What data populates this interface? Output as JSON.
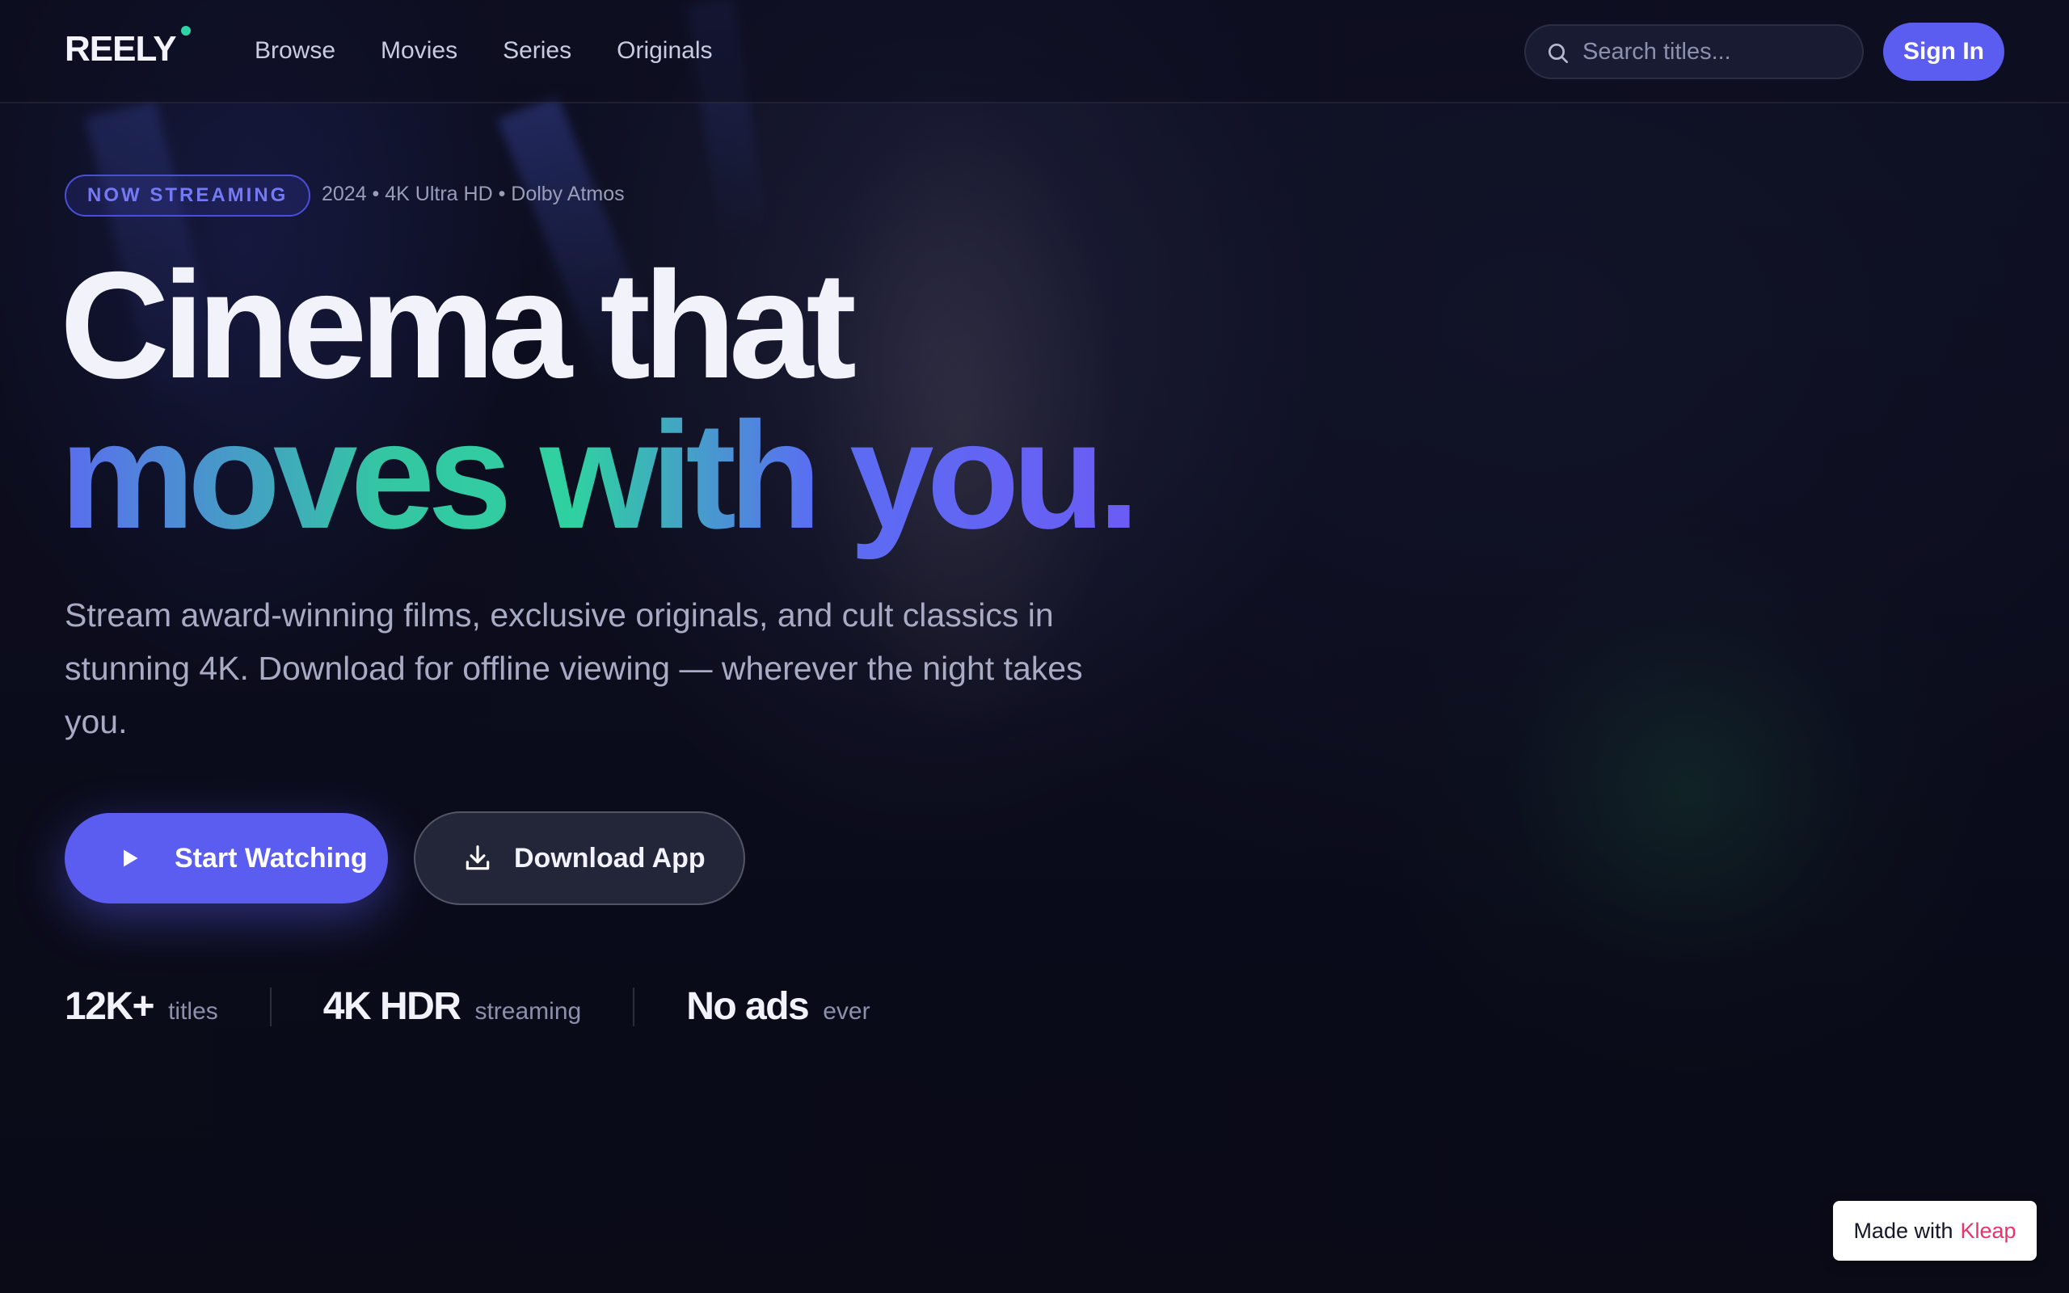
{
  "brand": {
    "logo": "REELY",
    "accent": "#2dd4a6"
  },
  "nav": {
    "links": [
      "Browse",
      "Movies",
      "Series",
      "Originals"
    ],
    "search_placeholder": "Search titles...",
    "signin_label": "Sign In"
  },
  "hero": {
    "badge": "NOW STREAMING",
    "meta": "2024 • 4K Ultra HD • Dolby Atmos",
    "headline_line1": "Cinema that",
    "headline_line2": "moves with you.",
    "subtitle": "Stream award-winning films, exclusive originals, and cult classics in stunning 4K. Download for offline viewing — wherever the night takes you.",
    "primary_cta": "Start Watching",
    "secondary_cta": "Download App"
  },
  "stats": [
    {
      "value": "12K+",
      "label": "titles"
    },
    {
      "value": "4K HDR",
      "label": "streaming"
    },
    {
      "value": "No ads",
      "label": "ever"
    }
  ],
  "footer_badge": {
    "prefix": "Made with",
    "brand": "Kleap"
  },
  "colors": {
    "primary": "#5b5cf0",
    "background": "#0b0c1a",
    "gradient_green": "#2fd1a0",
    "gradient_blue": "#5b6cf0"
  },
  "icons": [
    "search-icon",
    "play-icon",
    "download-icon"
  ]
}
